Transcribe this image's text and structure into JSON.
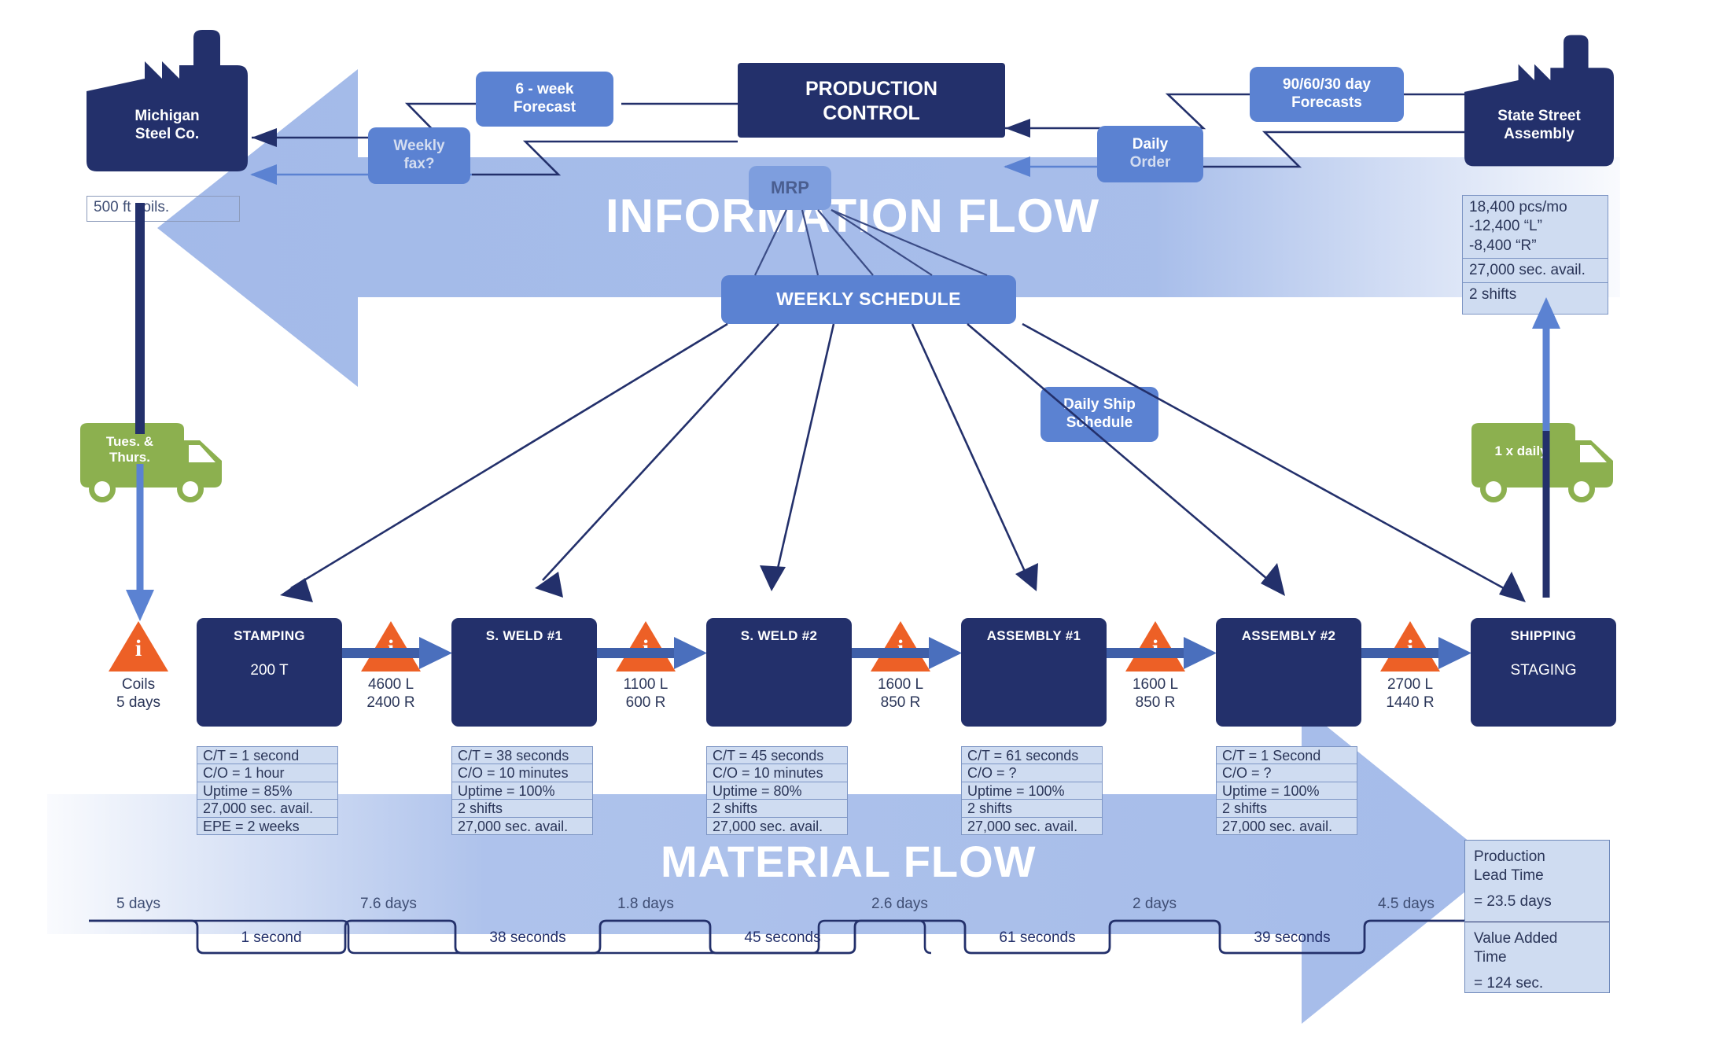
{
  "bands": {
    "information_flow_label": "INFORMATION FLOW",
    "material_flow_label": "MATERIAL FLOW"
  },
  "suppliers": {
    "left": {
      "name_line1": "Michigan",
      "name_line2": "Steel Co.",
      "note": "500 ft coils."
    },
    "right": {
      "name_line1": "State Street",
      "name_line2": "Assembly",
      "data": [
        "18,400 pcs/mo",
        "-12,400 “L”",
        "-8,400 “R”",
        "27,000 sec. avail.",
        "2 shifts"
      ]
    }
  },
  "control": {
    "title_line1": "PRODUCTION",
    "title_line2": "CONTROL",
    "mrp_label": "MRP",
    "weekly_schedule_label": "WEEKLY SCHEDULE"
  },
  "info_pills": {
    "six_week_forecast_line1": "6 - week",
    "six_week_forecast_line2": "Forecast",
    "weekly_fax_line1": "Weekly",
    "weekly_fax_line2": "fax?",
    "forecasts_line1": "90/60/30 day",
    "forecasts_line2": "Forecasts",
    "daily_order_line1": "Daily",
    "daily_order_line2": "Order",
    "daily_ship_line1": "Daily Ship",
    "daily_ship_line2": "Schedule"
  },
  "trucks": {
    "inbound_line1": "Tues. &",
    "inbound_line2": "Thurs.",
    "outbound": "1 x daily"
  },
  "inventories": [
    {
      "icon": "i",
      "line1": "Coils",
      "line2": "5 days"
    },
    {
      "icon": "i",
      "line1": "4600 L",
      "line2": "2400 R"
    },
    {
      "icon": "i",
      "line1": "1100 L",
      "line2": "600 R"
    },
    {
      "icon": "i",
      "line1": "1600 L",
      "line2": "850 R"
    },
    {
      "icon": "i",
      "line1": "1600 L",
      "line2": "850 R"
    },
    {
      "icon": "i",
      "line1": "2700 L",
      "line2": "1440 R"
    }
  ],
  "processes": [
    {
      "title": "STAMPING",
      "sub": "200 T",
      "data": [
        "C/T = 1 second",
        "C/O = 1 hour",
        "Uptime = 85%",
        "27,000 sec. avail.",
        "EPE = 2 weeks"
      ]
    },
    {
      "title": "S. WELD #1",
      "sub": "",
      "data": [
        "C/T = 38 seconds",
        "C/O = 10 minutes",
        "Uptime = 100%",
        "2 shifts",
        "27,000 sec. avail."
      ]
    },
    {
      "title": "S. WELD #2",
      "sub": "",
      "data": [
        "C/T = 45 seconds",
        "C/O = 10 minutes",
        "Uptime = 80%",
        "2 shifts",
        "27,000 sec. avail."
      ]
    },
    {
      "title": "ASSEMBLY #1",
      "sub": "",
      "data": [
        "C/T = 61 seconds",
        "C/O = ?",
        "Uptime = 100%",
        "2 shifts",
        "27,000 sec. avail."
      ]
    },
    {
      "title": "ASSEMBLY #2",
      "sub": "",
      "data": [
        "C/T = 1 Second",
        "C/O = ?",
        "Uptime = 100%",
        "2 shifts",
        "27,000 sec. avail."
      ]
    },
    {
      "title": "SHIPPING",
      "sub": "STAGING",
      "data": []
    }
  ],
  "timeline": {
    "lead_times": [
      "5 days",
      "7.6 days",
      "1.8 days",
      "2.6 days",
      "2 days",
      "4.5 days"
    ],
    "value_times": [
      "1 second",
      "38 seconds",
      "45 seconds",
      "61 seconds",
      "39 seconds"
    ]
  },
  "summary": {
    "lead_label_line1": "Production",
    "lead_label_line2": "Lead Time",
    "lead_value": "= 23.5 days",
    "va_label_line1": "Value Added",
    "va_label_line2": "Time",
    "va_value": "= 124 sec."
  },
  "colors": {
    "navy": "#23306b",
    "blue": "#5b82d2",
    "light_blue": "#8fabe4",
    "orange": "#ed6026",
    "green": "#8cb04f",
    "databox": "#cfdcf1"
  }
}
